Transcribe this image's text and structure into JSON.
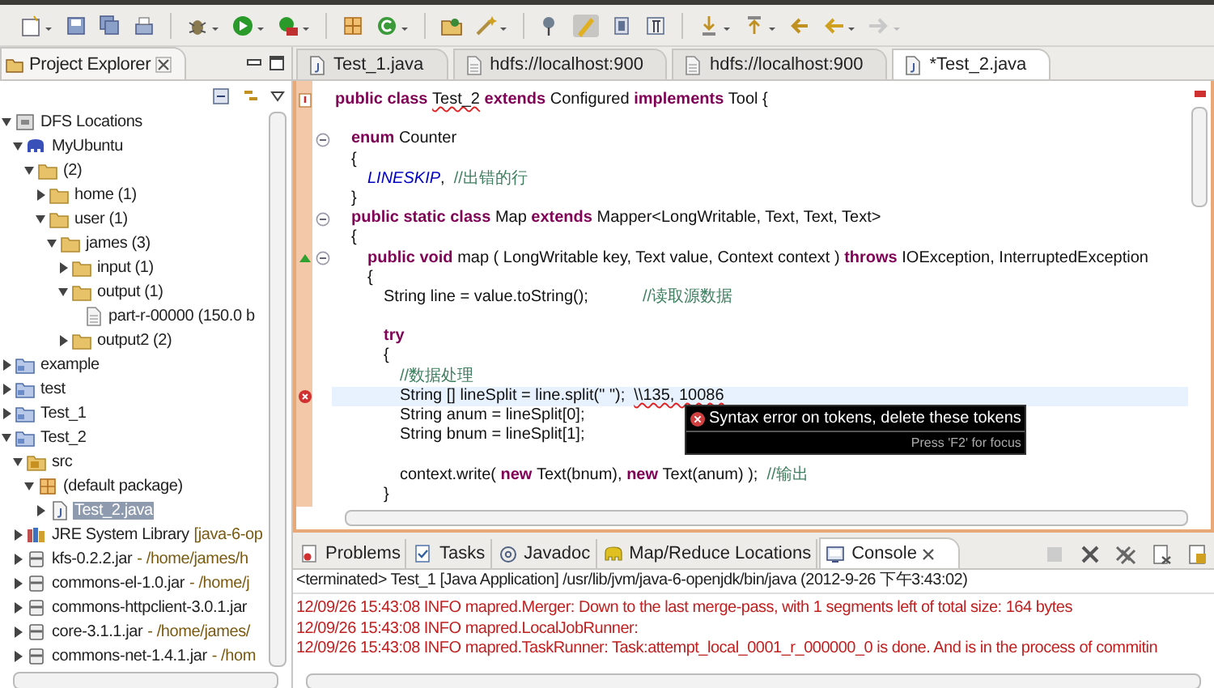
{
  "explorer": {
    "title": "Project Explorer",
    "tree": [
      {
        "label": "DFS Locations",
        "kind": "dfs",
        "expanded": true,
        "selected": false,
        "children": [
          {
            "label": "MyUbuntu",
            "kind": "location",
            "expanded": true,
            "selected": false,
            "children": [
              {
                "label": "(2)",
                "kind": "folder",
                "expanded": true,
                "selected": false,
                "children": [
                  {
                    "label": "home (1)",
                    "kind": "folder",
                    "expanded": false,
                    "selected": false
                  },
                  {
                    "label": "user (1)",
                    "kind": "folder",
                    "expanded": true,
                    "selected": false,
                    "children": [
                      {
                        "label": "james (3)",
                        "kind": "folder",
                        "expanded": true,
                        "selected": false,
                        "children": [
                          {
                            "label": "input (1)",
                            "kind": "folder",
                            "expanded": false,
                            "selected": false
                          },
                          {
                            "label": "output (1)",
                            "kind": "folder",
                            "expanded": true,
                            "selected": false,
                            "children": [
                              {
                                "label": "part-r-00000 (150.0 b",
                                "kind": "file",
                                "selected": false
                              }
                            ]
                          },
                          {
                            "label": "output2 (2)",
                            "kind": "folder",
                            "expanded": false,
                            "selected": false
                          }
                        ]
                      }
                    ]
                  }
                ]
              }
            ]
          }
        ]
      },
      {
        "label": "example",
        "kind": "project",
        "expanded": false,
        "selected": false
      },
      {
        "label": "test",
        "kind": "project",
        "expanded": false,
        "selected": false
      },
      {
        "label": "Test_1",
        "kind": "project",
        "expanded": false,
        "selected": false
      },
      {
        "label": "Test_2",
        "kind": "project",
        "expanded": true,
        "selected": false,
        "children": [
          {
            "label": "src",
            "kind": "source",
            "expanded": true,
            "selected": false,
            "children": [
              {
                "label": "(default package)",
                "kind": "package",
                "expanded": true,
                "selected": false,
                "children": [
                  {
                    "label": "Test_2.java",
                    "kind": "java",
                    "expanded": false,
                    "selected": true
                  }
                ]
              }
            ]
          },
          {
            "label": "JRE System Library",
            "detail": "[java-6-op",
            "kind": "library",
            "expanded": false,
            "selected": false
          },
          {
            "label": "kfs-0.2.2.jar",
            "detail": "- /home/james/h",
            "kind": "jar",
            "expanded": false,
            "selected": false
          },
          {
            "label": "commons-el-1.0.jar",
            "detail": "- /home/j",
            "kind": "jar",
            "expanded": false,
            "selected": false
          },
          {
            "label": "commons-httpclient-3.0.1.jar",
            "kind": "jar",
            "expanded": false,
            "selected": false
          },
          {
            "label": "core-3.1.1.jar",
            "detail": "- /home/james/",
            "kind": "jar",
            "expanded": false,
            "selected": false
          },
          {
            "label": "commons-net-1.4.1.jar",
            "detail": "- /hom",
            "kind": "jar",
            "expanded": false,
            "selected": false
          }
        ]
      }
    ]
  },
  "editor": {
    "tabs": [
      {
        "label": "Test_1.java",
        "kind": "java",
        "selected": false
      },
      {
        "label": "hdfs://localhost:900",
        "kind": "file",
        "selected": false
      },
      {
        "label": "hdfs://localhost:900",
        "kind": "file",
        "selected": false
      },
      {
        "label": "*Test_2.java",
        "kind": "java",
        "selected": true
      }
    ],
    "lines": [
      {
        "kind": "code",
        "current": false,
        "warning": true,
        "tokens": [
          {
            "kind": "keyword",
            "text": "public class "
          },
          {
            "kind": "squiggle",
            "text": "Test_2"
          },
          {
            "kind": "keyword",
            "text": " extends "
          },
          {
            "kind": "plain",
            "text": "Configured "
          },
          {
            "kind": "keyword",
            "text": "implements "
          },
          {
            "kind": "plain",
            "text": "Tool {"
          }
        ]
      },
      {
        "kind": "blank"
      },
      {
        "kind": "code",
        "current": false,
        "fold": true,
        "tokens": [
          {
            "kind": "keyword",
            "text": "\tenum "
          },
          {
            "kind": "plain",
            "text": "Counter"
          }
        ]
      },
      {
        "kind": "code",
        "current": false,
        "tokens": [
          {
            "kind": "plain",
            "text": "\t{"
          }
        ]
      },
      {
        "kind": "code",
        "current": false,
        "tokens": [
          {
            "kind": "constant",
            "text": "\t\tLINESKIP"
          },
          {
            "kind": "plain",
            "text": ",  "
          },
          {
            "kind": "comment",
            "text": "//出错的行"
          }
        ]
      },
      {
        "kind": "code",
        "current": false,
        "tokens": [
          {
            "kind": "plain",
            "text": "\t}"
          }
        ]
      },
      {
        "kind": "code",
        "current": false,
        "fold": true,
        "tokens": [
          {
            "kind": "keyword",
            "text": "\tpublic static class "
          },
          {
            "kind": "plain",
            "text": "Map "
          },
          {
            "kind": "keyword",
            "text": "extends "
          },
          {
            "kind": "plain",
            "text": "Mapper<LongWritable, Text, Text, Text>"
          }
        ]
      },
      {
        "kind": "code",
        "current": false,
        "tokens": [
          {
            "kind": "plain",
            "text": "\t{"
          }
        ]
      },
      {
        "kind": "code",
        "current": false,
        "override": true,
        "fold": true,
        "tokens": [
          {
            "kind": "keyword",
            "text": "\t\tpublic void "
          },
          {
            "kind": "plain",
            "text": "map ( LongWritable key, Text value, Context context ) "
          },
          {
            "kind": "keyword",
            "text": "throws "
          },
          {
            "kind": "plain",
            "text": "IOException, InterruptedException"
          }
        ]
      },
      {
        "kind": "code",
        "current": false,
        "tokens": [
          {
            "kind": "plain",
            "text": "\t\t{"
          }
        ]
      },
      {
        "kind": "code",
        "current": false,
        "tokens": [
          {
            "kind": "plain",
            "text": "\t\t\tString line = value.toString();\t\t\t\t"
          },
          {
            "kind": "comment",
            "text": "//读取源数据"
          }
        ]
      },
      {
        "kind": "blank"
      },
      {
        "kind": "code",
        "current": false,
        "tokens": [
          {
            "kind": "keyword",
            "text": "\t\t\ttry"
          }
        ]
      },
      {
        "kind": "code",
        "current": false,
        "tokens": [
          {
            "kind": "plain",
            "text": "\t\t\t{"
          }
        ]
      },
      {
        "kind": "code",
        "current": false,
        "tokens": [
          {
            "kind": "comment",
            "text": "\t\t\t\t//数据处理"
          }
        ]
      },
      {
        "kind": "code",
        "current": true,
        "error": true,
        "tokens": [
          {
            "kind": "plain",
            "text": "\t\t\t\tString [] lineSplit = line.split(\" \");  "
          },
          {
            "kind": "squiggle",
            "text": "\\\\135, 10086"
          }
        ]
      },
      {
        "kind": "code",
        "current": false,
        "tokens": [
          {
            "kind": "plain",
            "text": "\t\t\t\tString anum = lineSplit[0];"
          }
        ]
      },
      {
        "kind": "code",
        "current": false,
        "tokens": [
          {
            "kind": "plain",
            "text": "\t\t\t\tString bnum = lineSplit[1];"
          }
        ]
      },
      {
        "kind": "blank"
      },
      {
        "kind": "code",
        "current": false,
        "tokens": [
          {
            "kind": "plain",
            "text": "\t\t\t\tcontext.write( "
          },
          {
            "kind": "keyword",
            "text": "new "
          },
          {
            "kind": "plain",
            "text": "Text(bnum), "
          },
          {
            "kind": "keyword",
            "text": "new "
          },
          {
            "kind": "plain",
            "text": "Text(anum) );  "
          },
          {
            "kind": "comment",
            "text": "//输出"
          }
        ]
      },
      {
        "kind": "code",
        "current": false,
        "tokens": [
          {
            "kind": "plain",
            "text": "\t\t\t}"
          }
        ]
      }
    ],
    "tooltip": {
      "message": "Syntax error on tokens, delete these tokens",
      "hint": "Press 'F2' for focus"
    }
  },
  "bottom_panel": {
    "tabs": [
      {
        "label": "Problems",
        "kind": "problems",
        "selected": false
      },
      {
        "label": "Tasks",
        "kind": "tasks",
        "selected": false
      },
      {
        "label": "Javadoc",
        "kind": "javadoc",
        "selected": false
      },
      {
        "label": "Map/Reduce Locations",
        "kind": "mapreduce",
        "selected": false
      },
      {
        "label": "Console",
        "kind": "console",
        "selected": true
      }
    ],
    "header": "<terminated> Test_1 [Java Application] /usr/lib/jvm/java-6-openjdk/bin/java (2012-9-26 下午3:43:02)",
    "lines": [
      "12/09/26 15:43:08 INFO mapred.Merger: Down to the last merge-pass, with 1 segments left of total size: 164 bytes",
      "12/09/26 15:43:08 INFO mapred.LocalJobRunner:",
      "12/09/26 15:43:08 INFO mapred.TaskRunner: Task:attempt_local_0001_r_000000_0 is done. And is in the process of commitin"
    ]
  }
}
